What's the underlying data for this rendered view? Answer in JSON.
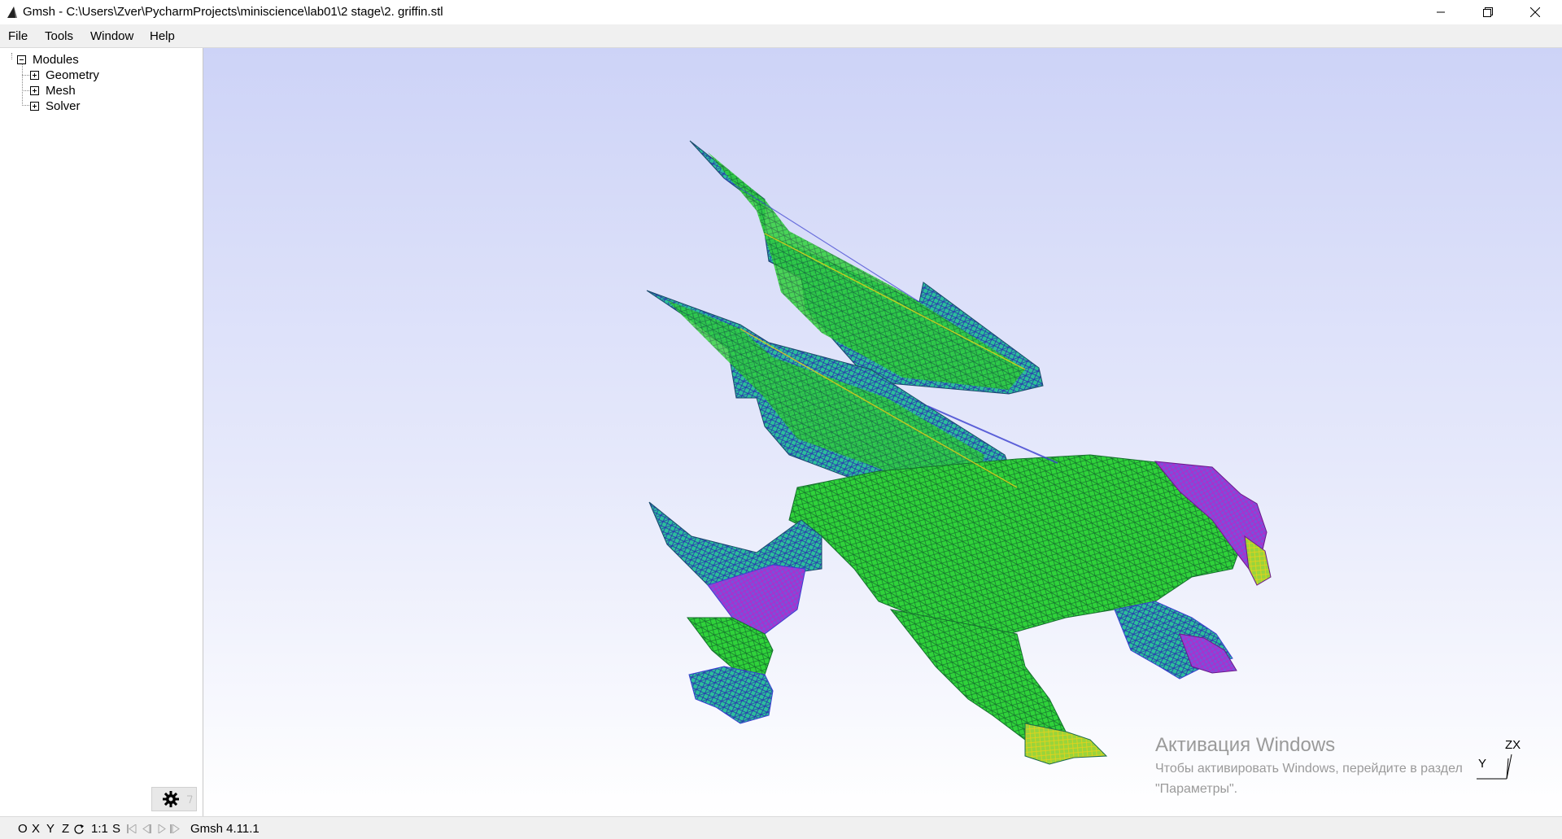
{
  "window": {
    "title": "Gmsh - C:\\Users\\Zver\\PycharmProjects\\miniscience\\lab01\\2 stage\\2. griffin.stl"
  },
  "menu": {
    "file": "File",
    "tools": "Tools",
    "window": "Window",
    "help": "Help"
  },
  "tree": {
    "root": "Modules",
    "items": [
      "Geometry",
      "Mesh",
      "Solver"
    ]
  },
  "viewport": {
    "watermark_title": "Активация Windows",
    "watermark_line1": "Чтобы активировать Windows, перейдите в раздел",
    "watermark_line2": "\"Параметры\".",
    "axes": {
      "y": "Y",
      "zx": "ZX"
    },
    "model_icon": "griffin-wireframe-mesh",
    "mesh_colors": [
      "#1fd42a",
      "#2bbf9a",
      "#3a3fd0",
      "#c020c8",
      "#e6d21a",
      "#1a6a4a"
    ]
  },
  "statusbar": {
    "btn_o": "O",
    "btn_x": "X",
    "btn_y": "Y",
    "btn_z": "Z",
    "btn_rotate_icon": "rotate-icon",
    "btn_scale": "1:1",
    "btn_s": "S",
    "anim_icons": [
      "first-step-icon",
      "prev-step-icon",
      "play-icon",
      "next-step-icon"
    ],
    "version": "Gmsh 4.11.1"
  },
  "settings_icon": "gear-icon"
}
